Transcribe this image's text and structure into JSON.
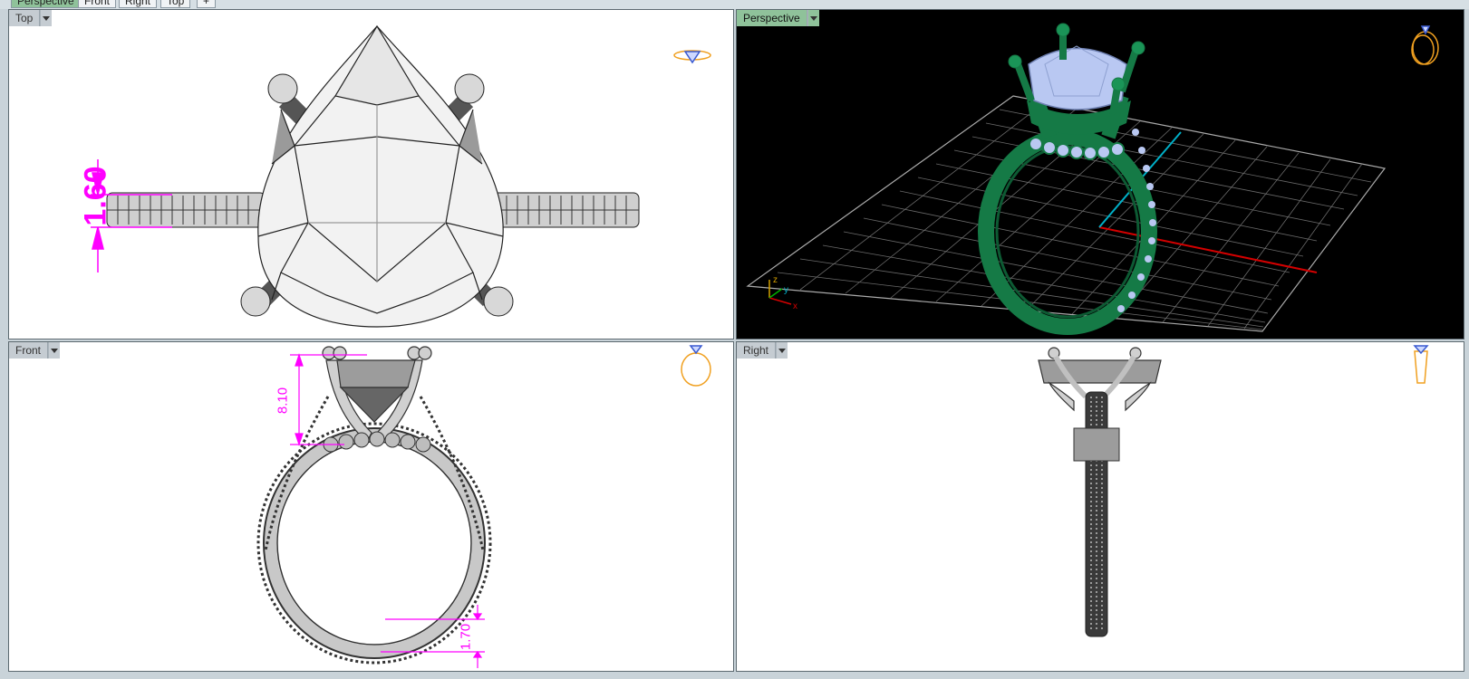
{
  "tabs": [
    {
      "label": "Perspective",
      "active": true
    },
    {
      "label": "Front",
      "active": false
    },
    {
      "label": "Right",
      "active": false
    },
    {
      "label": "Top",
      "active": false
    },
    {
      "label": "+",
      "active": false
    }
  ],
  "viewports": {
    "top": {
      "title": "Top",
      "dimension": "1.60"
    },
    "perspective": {
      "title": "Perspective",
      "axis_x": "x",
      "axis_y": "y",
      "axis_z": "z"
    },
    "front": {
      "title": "Front",
      "dimension_upper": "8.10",
      "dimension_lower": "1.70"
    },
    "right": {
      "title": "Right"
    }
  },
  "colors": {
    "dimension": "#ff00ff",
    "ring_green": "#157a46",
    "gem_blue": "#b9c8f2",
    "thumbnail": "#f0a020",
    "axis_x": "#d40000",
    "axis_y": "#00b0c8"
  }
}
